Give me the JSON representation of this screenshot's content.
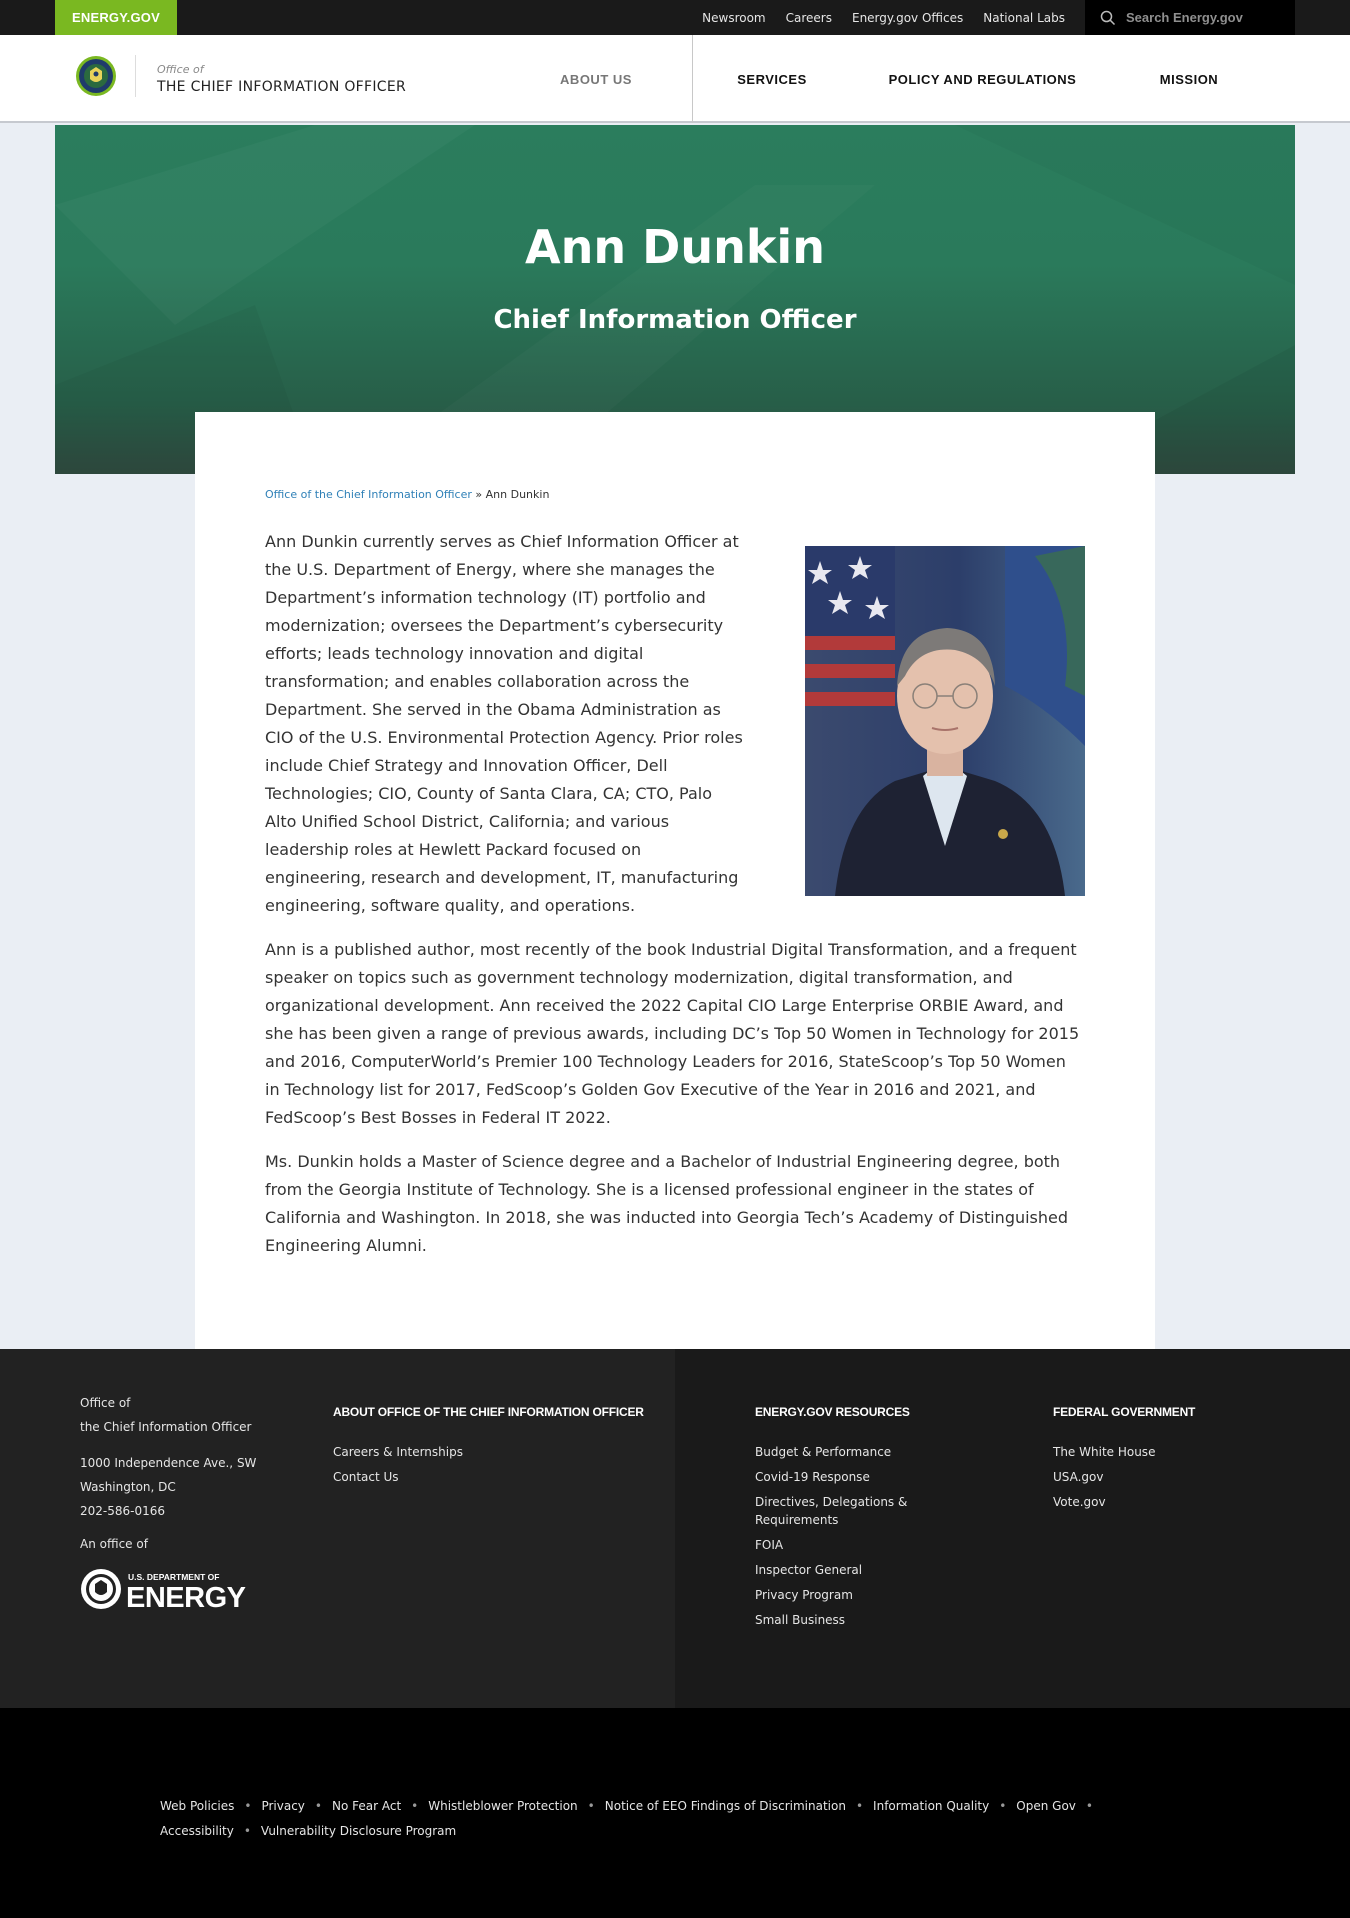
{
  "topbar": {
    "brand": "ENERGY.GOV",
    "links": [
      "Newsroom",
      "Careers",
      "Energy.gov Offices",
      "National Labs"
    ],
    "search_placeholder": "Search Energy.gov"
  },
  "header": {
    "office_label": "Office of",
    "office_name": "THE CHIEF INFORMATION OFFICER",
    "nav": [
      "ABOUT US",
      "SERVICES",
      "POLICY AND REGULATIONS",
      "MISSION"
    ]
  },
  "hero": {
    "name": "Ann Dunkin",
    "title": "Chief Information Officer"
  },
  "breadcrumb": {
    "link": "Office of the Chief Information Officer",
    "separator": "»",
    "current": "Ann Dunkin"
  },
  "bio": {
    "p1": "Ann Dunkin currently serves as Chief Information Officer at the U.S. Department of Energy, where she manages the Department’s information technology (IT) portfolio and modernization; oversees the Department’s cybersecurity efforts; leads technology innovation and digital transformation; and enables collaboration across the Department. She served in the Obama Administration as CIO of the U.S. Environmental Protection Agency. Prior roles include Chief Strategy and Innovation Officer, Dell Technologies; CIO, County of Santa Clara, CA; CTO, Palo Alto Unified School District, California; and various leadership roles at Hewlett Packard focused on engineering, research and development, IT, manufacturing engineering, software quality, and operations.",
    "p2": "Ann is a published author, most recently of the book Industrial Digital Transformation, and a frequent speaker on topics such as government technology modernization, digital transformation, and organizational development. Ann received the 2022 Capital CIO Large Enterprise ORBIE Award, and she has been given a range of previous awards, including DC’s Top 50 Women in Technology for 2015 and 2016, ComputerWorld’s Premier 100 Technology Leaders for 2016, StateScoop’s Top 50 Women in Technology list for 2017, FedScoop’s Golden Gov Executive of the Year in 2016 and 2021, and FedScoop’s Best Bosses in Federal IT 2022.",
    "p3": "Ms. Dunkin holds a Master of Science degree and a Bachelor of Industrial Engineering degree, both from the Georgia Institute of Technology. She is a licensed professional engineer in the states of California and Washington. In 2018, she was inducted into Georgia Tech’s Academy of Distinguished Engineering Alumni."
  },
  "footer": {
    "address": {
      "line1": "Office of",
      "line2": "the Chief Information Officer",
      "street": "1000 Independence Ave., SW",
      "city": "Washington, DC",
      "phone": "202-586-0166"
    },
    "office_of": "An office of",
    "doe_logo": {
      "small": "U.S. DEPARTMENT OF",
      "big": "ENERGY"
    },
    "col1": {
      "heading": "ABOUT OFFICE OF THE CHIEF INFORMATION OFFICER",
      "links": [
        "Careers & Internships",
        "Contact Us"
      ]
    },
    "col2": {
      "heading": "ENERGY.GOV RESOURCES",
      "links": [
        "Budget & Performance",
        "Covid-19 Response",
        "Directives, Delegations & Requirements",
        "FOIA",
        "Inspector General",
        "Privacy Program",
        "Small Business"
      ]
    },
    "col3": {
      "heading": "FEDERAL GOVERNMENT",
      "links": [
        "The White House",
        "USA.gov",
        "Vote.gov"
      ]
    }
  },
  "legal_links": [
    "Web Policies",
    "Privacy",
    "No Fear Act",
    "Whistleblower Protection",
    "Notice of EEO Findings of Discrimination",
    "Information Quality",
    "Open Gov",
    "Accessibility",
    "Vulnerability Disclosure Program"
  ],
  "colors": {
    "brand_green": "#7ab821",
    "hero_green": "#2b7d5d",
    "link_blue": "#2f80b7"
  }
}
